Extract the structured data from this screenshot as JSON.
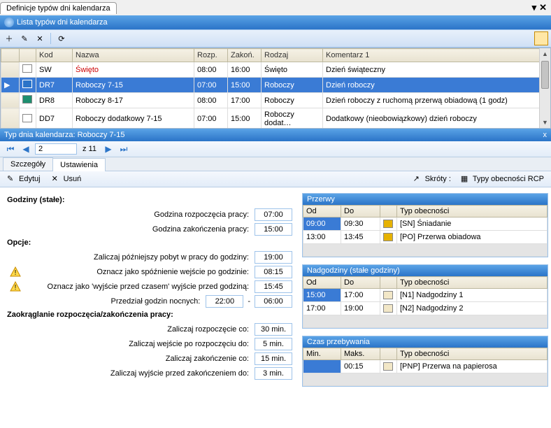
{
  "window": {
    "tab_title": "Definicje typów dni kalendarza",
    "list_title": "Lista typów dni kalendarza"
  },
  "columns": {
    "kod": "Kod",
    "nazwa": "Nazwa",
    "rozp": "Rozp.",
    "zakon": "Zakoń.",
    "rodzaj": "Rodzaj",
    "komentarz": "Komentarz 1"
  },
  "rows": [
    {
      "color": "#ffffff",
      "kod": "SW",
      "nazwa": "Święto",
      "r": "08:00",
      "z": "16:00",
      "rodzaj": "Święto",
      "kom": "Dzień świąteczny",
      "red": true
    },
    {
      "color": "#2b74c8",
      "kod": "DR7",
      "nazwa": "Roboczy 7-15",
      "r": "07:00",
      "z": "15:00",
      "rodzaj": "Roboczy",
      "kom": "Dzień roboczy",
      "selected": true
    },
    {
      "color": "#1e8f6f",
      "kod": "DR8",
      "nazwa": "Roboczy 8-17",
      "r": "08:00",
      "z": "17:00",
      "rodzaj": "Roboczy",
      "kom": "Dzień roboczy z ruchomą przerwą obiadową (1 godz)"
    },
    {
      "color": "#ffffff",
      "kod": "DD7",
      "nazwa": "Roboczy dodatkowy 7-15",
      "r": "07:00",
      "z": "15:00",
      "rodzaj": "Roboczy dodat…",
      "kom": "Dodatkowy (nieobowiązkowy) dzień roboczy"
    }
  ],
  "detail": {
    "title": "Typ dnia kalendarza: Roboczy 7-15",
    "close": "x",
    "nav_pos": "2",
    "nav_of": "z 11"
  },
  "tabs": {
    "szczegoly": "Szczegóły",
    "ustawienia": "Ustawienia"
  },
  "actions": {
    "edytuj": "Edytuj",
    "usun": "Usuń",
    "skroty": "Skróty :",
    "typy_rcp": "Typy obecności RCP"
  },
  "left": {
    "godziny_title": "Godziny (stałe):",
    "g_rozp_label": "Godzina rozpoczęcia pracy:",
    "g_rozp_val": "07:00",
    "g_zak_label": "Godzina zakończenia pracy:",
    "g_zak_val": "15:00",
    "opcje_title": "Opcje:",
    "opt1_label": "Zaliczaj późniejszy pobyt w pracy do godziny:",
    "opt1_val": "19:00",
    "opt2_label": "Oznacz jako spóźnienie wejście po godzinie:",
    "opt2_val": "08:15",
    "opt3_label": "Oznacz jako 'wyjście przed czasem' wyjście przed godziną:",
    "opt3_val": "15:45",
    "opt4_label": "Przedział godzin nocnych:",
    "opt4_from": "22:00",
    "opt4_to": "06:00",
    "zaokr_title": "Zaokrąglanie rozpoczęcia/zakończenia pracy:",
    "z1_label": "Zaliczaj rozpoczęcie co:",
    "z1_val": "30 min.",
    "z2_label": "Zaliczaj wejście po rozpoczęciu do:",
    "z2_val": "5 min.",
    "z3_label": "Zaliczaj zakończenie co:",
    "z3_val": "15 min.",
    "z4_label": "Zaliczaj wyjście przed zakończeniem do:",
    "z4_val": "3 min."
  },
  "right": {
    "przerwy_title": "Przerwy",
    "col_od": "Od",
    "col_do": "Do",
    "col_typ": "Typ obecności",
    "przerwy": [
      {
        "od": "09:00",
        "do": "09:30",
        "color": "#e6b200",
        "typ": "[SN] Śniadanie",
        "sel": true
      },
      {
        "od": "13:00",
        "do": "13:45",
        "color": "#e6b200",
        "typ": "[PO] Przerwa obiadowa"
      }
    ],
    "nadg_title": "Nadgodziny (stałe godziny)",
    "nadg": [
      {
        "od": "15:00",
        "do": "17:00",
        "color": "#f2e7c7",
        "typ": "[N1] Nadgodziny 1",
        "sel": true
      },
      {
        "od": "17:00",
        "do": "19:00",
        "color": "#f2e7c7",
        "typ": "[N2] Nadgodziny 2"
      }
    ],
    "czas_title": "Czas przebywania",
    "col_min": "Min.",
    "col_max": "Maks.",
    "czas": [
      {
        "min": "",
        "max": "00:15",
        "color": "#f2e7c7",
        "typ": "[PNP] Przerwa na papierosa",
        "sel": true
      }
    ]
  }
}
